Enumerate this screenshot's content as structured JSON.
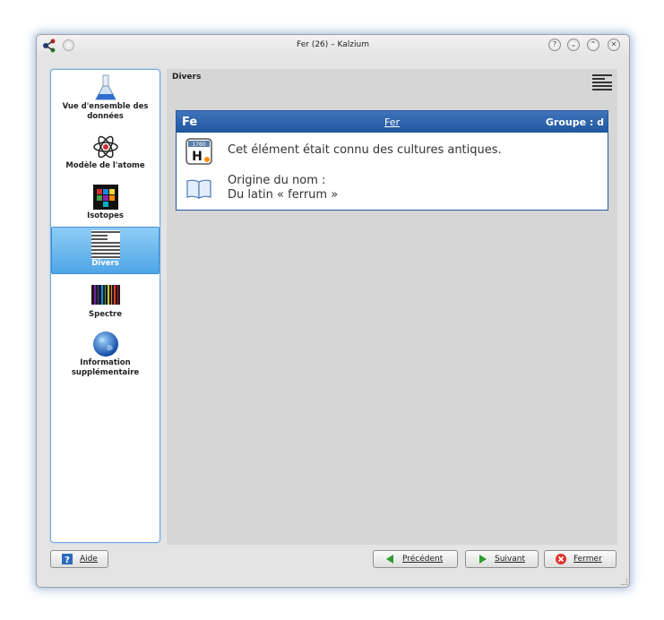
{
  "window": {
    "title": "Fer (26) – Kalzium"
  },
  "titlebar_buttons": {
    "help": "?",
    "minimize": "⌄",
    "maximize": "⌃",
    "close": "✕"
  },
  "sidebar": {
    "items": [
      {
        "label": "Vue d'ensemble des données",
        "icon": "flask-icon"
      },
      {
        "label": "Modèle de l'atome",
        "icon": "atom-icon"
      },
      {
        "label": "Isotopes",
        "icon": "isotopes-icon"
      },
      {
        "label": "Divers",
        "icon": "misc-stripes-icon",
        "selected": true
      },
      {
        "label": "Spectre",
        "icon": "spectrum-icon"
      },
      {
        "label": "Information supplémentaire",
        "icon": "globe-icon"
      }
    ]
  },
  "page": {
    "header": "Divers",
    "element": {
      "symbol": "Fe",
      "name": "Fer",
      "group": "Groupe : d"
    },
    "rows": [
      {
        "icon": "history-icon",
        "badge": "1760",
        "text": "Cet élément était connu des cultures antiques."
      },
      {
        "icon": "book-icon",
        "line1": "Origine du nom :",
        "line2": "Du latin « ferrum »"
      }
    ]
  },
  "buttons": {
    "help": "Aide",
    "previous": "Précédent",
    "next": "Suivant",
    "close": "Fermer"
  },
  "colors": {
    "header_blue": "#1f579f",
    "selection_blue": "#4ea6e6",
    "window_bg": "#e4e4e4",
    "content_bg": "#d6d6d6"
  }
}
